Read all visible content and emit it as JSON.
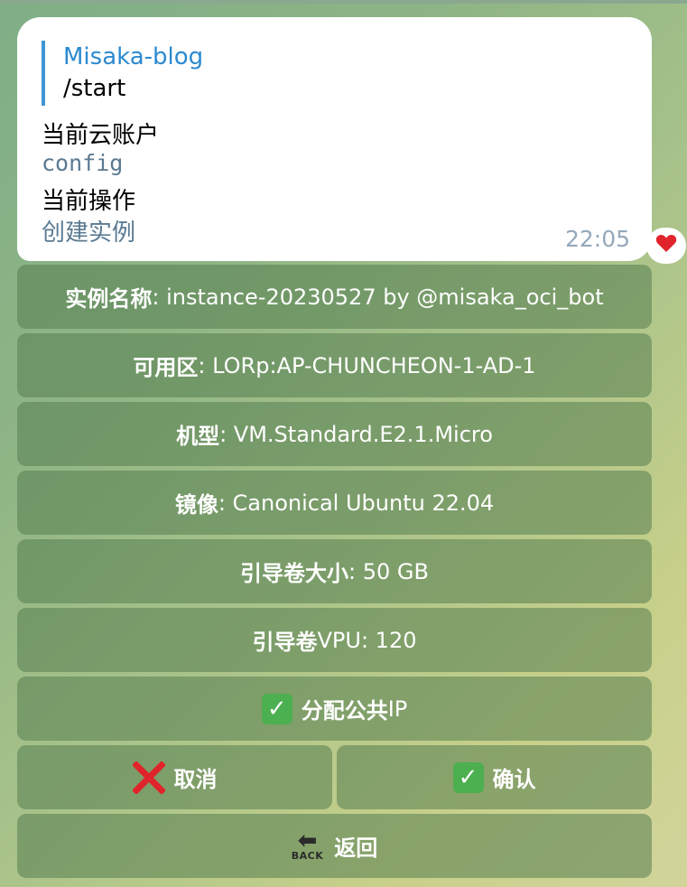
{
  "message": {
    "reply": {
      "sender": "Misaka-blog",
      "text": "/start"
    },
    "lines": [
      "当前云账户",
      "config",
      "当前操作",
      "创建实例"
    ],
    "time": "22:05",
    "reaction": "heart-icon"
  },
  "keyboard": {
    "instance_name": {
      "key": "实例名称",
      "value": ": instance-20230527 by @misaka_oci_bot"
    },
    "availability_domain": {
      "key": "可用区",
      "value": ": LORp:AP-CHUNCHEON-1-AD-1"
    },
    "shape": {
      "key": "机型",
      "value": ": VM.Standard.E2.1.Micro"
    },
    "image": {
      "key": "镜像",
      "value": ": Canonical Ubuntu 22.04"
    },
    "boot_volume_size": {
      "key": "引导卷大小",
      "value": ": 50 GB"
    },
    "boot_volume_vpu": {
      "key": "引导卷",
      "value": "VPU: 120"
    },
    "assign_public_ip": {
      "label": "分配公共",
      "suffix": "IP"
    },
    "cancel": {
      "label": "取消"
    },
    "confirm": {
      "label": "确认"
    },
    "back": {
      "label": "返回",
      "icon_text": "BACK"
    }
  },
  "colors": {
    "reply_bar": "#3d96d6",
    "sender": "#2c8ad0",
    "secondary_text": "#5b7a92",
    "button_bg": "rgba(85,125,80,0.55)",
    "check_green": "#4caf50",
    "cross_red": "#e0242b"
  }
}
